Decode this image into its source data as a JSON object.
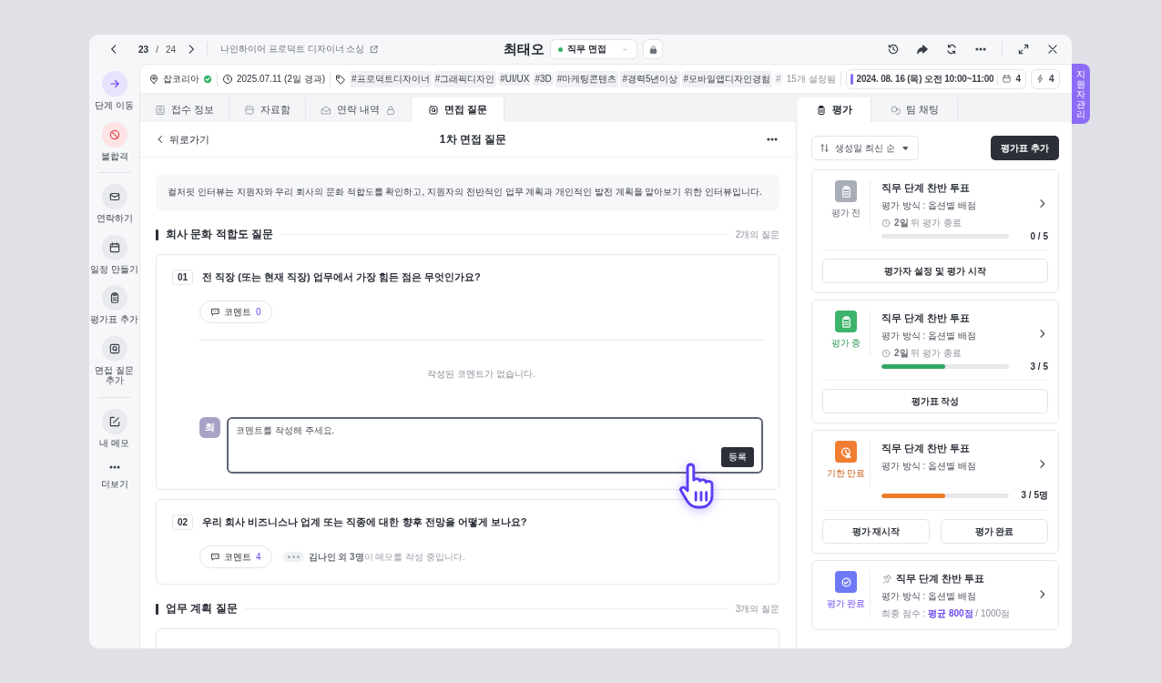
{
  "window": {
    "position": {
      "current": "23",
      "separator": "/",
      "total": "24"
    },
    "job_title": "나인하이어 프로덕트 디자이너 소싱",
    "candidate_name": "최태오",
    "stage": {
      "label": "직무 면접",
      "color": "#34b26a"
    }
  },
  "side_tab": {
    "label": "지원자 관리"
  },
  "sidebar": {
    "groups": [
      {
        "items": [
          {
            "kind": "primary",
            "label": "단계 이동"
          },
          {
            "kind": "danger",
            "label": "불합격"
          }
        ]
      },
      {
        "items": [
          {
            "kind": "normal",
            "label": "연락하기"
          },
          {
            "kind": "normal",
            "label": "일정 만들기"
          },
          {
            "kind": "normal",
            "label": "평가표 추가"
          },
          {
            "kind": "normal",
            "label": "면접 질문 추가"
          }
        ]
      },
      {
        "items": [
          {
            "kind": "normal",
            "label": "내 메모"
          },
          {
            "kind": "bare",
            "label": "더보기"
          }
        ]
      }
    ]
  },
  "info": {
    "source": {
      "label": "잡코리아",
      "verified": true
    },
    "applied": "2025.07.11 (2일 경과)",
    "tags": [
      "#프로덕트디자이너",
      "#그래픽디자인",
      "#UI/UX",
      "#3D",
      "#마케팅콘텐츠",
      "#경력5년이상",
      "#모바일앱디자인경험"
    ],
    "faded_tag": "#",
    "tag_count": "15개 설정됨",
    "schedule": "2024. 08. 16 (목) 오전 10:00~11:00",
    "schedule_count": "4",
    "badge_count": "4"
  },
  "tabs": [
    {
      "label": "접수 정보",
      "selected": false,
      "locked": false
    },
    {
      "label": "자료함",
      "selected": false,
      "locked": false
    },
    {
      "label": "연락 내역",
      "selected": false,
      "locked": true
    },
    {
      "label": "면접 질문",
      "selected": true,
      "locked": false
    }
  ],
  "question_page": {
    "back": "뒤로가기",
    "title": "1차 면접 질문",
    "intro": "컬처핏 인터뷰는 지원자와 우리 회사의 문화 적합도를 확인하고, 지원자의 전반적인 업무 계획과 개인적인 발전 계획을 알아보기 위한 인터뷰입니다.",
    "sections": [
      {
        "title": "회사 문화 적합도 질문",
        "count": "2개의 질문",
        "questions": [
          {
            "number": "01",
            "text": "전 직장 (또는 현재 직장) 업무에서 가장 힘든 점은 무엇인가요?",
            "comment_label": "코멘트",
            "comment_count": "0",
            "empty_note": "작성된 코멘트가 없습니다.",
            "composer": {
              "avatar": "최",
              "placeholder": "코멘트를 작성해 주세요.",
              "submit": "등록"
            }
          },
          {
            "number": "02",
            "text": "우리 회사 비즈니스나 업계 또는 직종에 대한 향후 전망을 어떻게 보나요?",
            "comment_label": "코멘트",
            "comment_count": "4",
            "typing": "**김나인 외 3명**이 메모를 작성 중입니다."
          }
        ]
      },
      {
        "title": "업무 계획 질문",
        "count": "3개의 질문"
      }
    ]
  },
  "right_tabs": [
    {
      "label": "평가",
      "selected": true
    },
    {
      "label": "팀 채팅",
      "selected": false
    }
  ],
  "evaluation": {
    "sort": "생성일 최신 순",
    "add_button": "평가표 추가",
    "cards": [
      {
        "kind": "pending",
        "status": "평가 전",
        "pinned": false,
        "title": "직무 단계 찬반 투표",
        "method": "평가 방식 : 옵션별 배점",
        "deadline": "**2일** 뒤 평가 종료",
        "level": 0,
        "reading": "0 / 5",
        "actions": [
          "평가자 설정 및 평가 시작"
        ]
      },
      {
        "kind": "progress",
        "status": "평가 중",
        "pinned": false,
        "title": "직무 단계 찬반 투표",
        "method": "평가 방식 : 옵션별 배점",
        "deadline": "**2일** 뒤 평가 종료",
        "level": 0.5,
        "reading": "3 / 5",
        "actions": [
          "평가표 작성"
        ]
      },
      {
        "kind": "expired",
        "status": "기한 만료",
        "pinned": false,
        "title": "직무 단계 찬반 투표",
        "method": "평가 방식 : 옵션별 배점",
        "level": 0.5,
        "reading": "3 / 5명",
        "actions": [
          "평가 재시작",
          "평가 완료"
        ]
      },
      {
        "kind": "done",
        "status": "평가 완료",
        "pinned": true,
        "title": "직무 단계 찬반 투표",
        "method": "평가 방식 : 옵션별 배점",
        "score": "최종 점수 : **평균 800점** / 1000점"
      }
    ]
  }
}
